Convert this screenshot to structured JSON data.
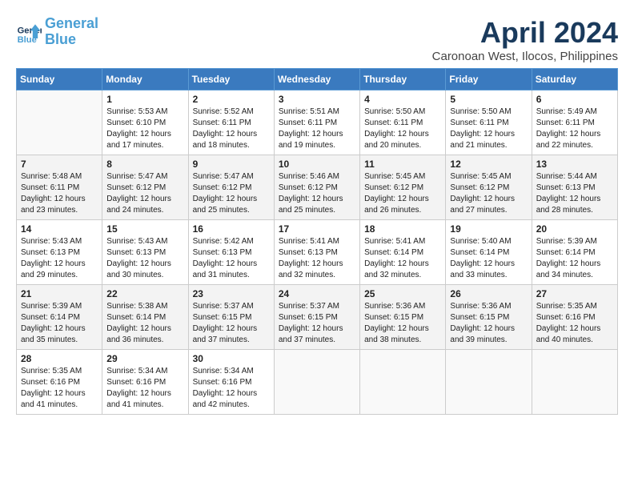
{
  "header": {
    "logo_line1": "General",
    "logo_line2": "Blue",
    "month_year": "April 2024",
    "location": "Caronoan West, Ilocos, Philippines"
  },
  "days_of_week": [
    "Sunday",
    "Monday",
    "Tuesday",
    "Wednesday",
    "Thursday",
    "Friday",
    "Saturday"
  ],
  "weeks": [
    [
      {
        "day": "",
        "info": ""
      },
      {
        "day": "1",
        "info": "Sunrise: 5:53 AM\nSunset: 6:10 PM\nDaylight: 12 hours\nand 17 minutes."
      },
      {
        "day": "2",
        "info": "Sunrise: 5:52 AM\nSunset: 6:11 PM\nDaylight: 12 hours\nand 18 minutes."
      },
      {
        "day": "3",
        "info": "Sunrise: 5:51 AM\nSunset: 6:11 PM\nDaylight: 12 hours\nand 19 minutes."
      },
      {
        "day": "4",
        "info": "Sunrise: 5:50 AM\nSunset: 6:11 PM\nDaylight: 12 hours\nand 20 minutes."
      },
      {
        "day": "5",
        "info": "Sunrise: 5:50 AM\nSunset: 6:11 PM\nDaylight: 12 hours\nand 21 minutes."
      },
      {
        "day": "6",
        "info": "Sunrise: 5:49 AM\nSunset: 6:11 PM\nDaylight: 12 hours\nand 22 minutes."
      }
    ],
    [
      {
        "day": "7",
        "info": "Sunrise: 5:48 AM\nSunset: 6:11 PM\nDaylight: 12 hours\nand 23 minutes."
      },
      {
        "day": "8",
        "info": "Sunrise: 5:47 AM\nSunset: 6:12 PM\nDaylight: 12 hours\nand 24 minutes."
      },
      {
        "day": "9",
        "info": "Sunrise: 5:47 AM\nSunset: 6:12 PM\nDaylight: 12 hours\nand 25 minutes."
      },
      {
        "day": "10",
        "info": "Sunrise: 5:46 AM\nSunset: 6:12 PM\nDaylight: 12 hours\nand 25 minutes."
      },
      {
        "day": "11",
        "info": "Sunrise: 5:45 AM\nSunset: 6:12 PM\nDaylight: 12 hours\nand 26 minutes."
      },
      {
        "day": "12",
        "info": "Sunrise: 5:45 AM\nSunset: 6:12 PM\nDaylight: 12 hours\nand 27 minutes."
      },
      {
        "day": "13",
        "info": "Sunrise: 5:44 AM\nSunset: 6:13 PM\nDaylight: 12 hours\nand 28 minutes."
      }
    ],
    [
      {
        "day": "14",
        "info": "Sunrise: 5:43 AM\nSunset: 6:13 PM\nDaylight: 12 hours\nand 29 minutes."
      },
      {
        "day": "15",
        "info": "Sunrise: 5:43 AM\nSunset: 6:13 PM\nDaylight: 12 hours\nand 30 minutes."
      },
      {
        "day": "16",
        "info": "Sunrise: 5:42 AM\nSunset: 6:13 PM\nDaylight: 12 hours\nand 31 minutes."
      },
      {
        "day": "17",
        "info": "Sunrise: 5:41 AM\nSunset: 6:13 PM\nDaylight: 12 hours\nand 32 minutes."
      },
      {
        "day": "18",
        "info": "Sunrise: 5:41 AM\nSunset: 6:14 PM\nDaylight: 12 hours\nand 32 minutes."
      },
      {
        "day": "19",
        "info": "Sunrise: 5:40 AM\nSunset: 6:14 PM\nDaylight: 12 hours\nand 33 minutes."
      },
      {
        "day": "20",
        "info": "Sunrise: 5:39 AM\nSunset: 6:14 PM\nDaylight: 12 hours\nand 34 minutes."
      }
    ],
    [
      {
        "day": "21",
        "info": "Sunrise: 5:39 AM\nSunset: 6:14 PM\nDaylight: 12 hours\nand 35 minutes."
      },
      {
        "day": "22",
        "info": "Sunrise: 5:38 AM\nSunset: 6:14 PM\nDaylight: 12 hours\nand 36 minutes."
      },
      {
        "day": "23",
        "info": "Sunrise: 5:37 AM\nSunset: 6:15 PM\nDaylight: 12 hours\nand 37 minutes."
      },
      {
        "day": "24",
        "info": "Sunrise: 5:37 AM\nSunset: 6:15 PM\nDaylight: 12 hours\nand 37 minutes."
      },
      {
        "day": "25",
        "info": "Sunrise: 5:36 AM\nSunset: 6:15 PM\nDaylight: 12 hours\nand 38 minutes."
      },
      {
        "day": "26",
        "info": "Sunrise: 5:36 AM\nSunset: 6:15 PM\nDaylight: 12 hours\nand 39 minutes."
      },
      {
        "day": "27",
        "info": "Sunrise: 5:35 AM\nSunset: 6:16 PM\nDaylight: 12 hours\nand 40 minutes."
      }
    ],
    [
      {
        "day": "28",
        "info": "Sunrise: 5:35 AM\nSunset: 6:16 PM\nDaylight: 12 hours\nand 41 minutes."
      },
      {
        "day": "29",
        "info": "Sunrise: 5:34 AM\nSunset: 6:16 PM\nDaylight: 12 hours\nand 41 minutes."
      },
      {
        "day": "30",
        "info": "Sunrise: 5:34 AM\nSunset: 6:16 PM\nDaylight: 12 hours\nand 42 minutes."
      },
      {
        "day": "",
        "info": ""
      },
      {
        "day": "",
        "info": ""
      },
      {
        "day": "",
        "info": ""
      },
      {
        "day": "",
        "info": ""
      }
    ]
  ]
}
